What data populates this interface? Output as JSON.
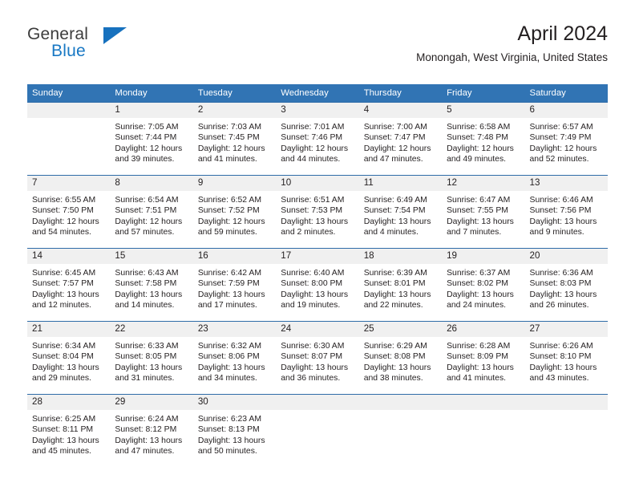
{
  "brand": {
    "name_part1": "General",
    "name_part2": "Blue",
    "accent_color": "#1878c4",
    "triangle_color": "#1771be"
  },
  "header": {
    "title": "April 2024",
    "subtitle": "Monongah, West Virginia, United States"
  },
  "calendar": {
    "header_bg": "#3174b4",
    "daynum_bg": "#f0f0f0",
    "columns": [
      "Sunday",
      "Monday",
      "Tuesday",
      "Wednesday",
      "Thursday",
      "Friday",
      "Saturday"
    ],
    "weeks": [
      [
        {
          "day": "",
          "empty": true
        },
        {
          "day": "1",
          "sunrise": "Sunrise: 7:05 AM",
          "sunset": "Sunset: 7:44 PM",
          "daylight": "Daylight: 12 hours and 39 minutes."
        },
        {
          "day": "2",
          "sunrise": "Sunrise: 7:03 AM",
          "sunset": "Sunset: 7:45 PM",
          "daylight": "Daylight: 12 hours and 41 minutes."
        },
        {
          "day": "3",
          "sunrise": "Sunrise: 7:01 AM",
          "sunset": "Sunset: 7:46 PM",
          "daylight": "Daylight: 12 hours and 44 minutes."
        },
        {
          "day": "4",
          "sunrise": "Sunrise: 7:00 AM",
          "sunset": "Sunset: 7:47 PM",
          "daylight": "Daylight: 12 hours and 47 minutes."
        },
        {
          "day": "5",
          "sunrise": "Sunrise: 6:58 AM",
          "sunset": "Sunset: 7:48 PM",
          "daylight": "Daylight: 12 hours and 49 minutes."
        },
        {
          "day": "6",
          "sunrise": "Sunrise: 6:57 AM",
          "sunset": "Sunset: 7:49 PM",
          "daylight": "Daylight: 12 hours and 52 minutes."
        }
      ],
      [
        {
          "day": "7",
          "sunrise": "Sunrise: 6:55 AM",
          "sunset": "Sunset: 7:50 PM",
          "daylight": "Daylight: 12 hours and 54 minutes."
        },
        {
          "day": "8",
          "sunrise": "Sunrise: 6:54 AM",
          "sunset": "Sunset: 7:51 PM",
          "daylight": "Daylight: 12 hours and 57 minutes."
        },
        {
          "day": "9",
          "sunrise": "Sunrise: 6:52 AM",
          "sunset": "Sunset: 7:52 PM",
          "daylight": "Daylight: 12 hours and 59 minutes."
        },
        {
          "day": "10",
          "sunrise": "Sunrise: 6:51 AM",
          "sunset": "Sunset: 7:53 PM",
          "daylight": "Daylight: 13 hours and 2 minutes."
        },
        {
          "day": "11",
          "sunrise": "Sunrise: 6:49 AM",
          "sunset": "Sunset: 7:54 PM",
          "daylight": "Daylight: 13 hours and 4 minutes."
        },
        {
          "day": "12",
          "sunrise": "Sunrise: 6:47 AM",
          "sunset": "Sunset: 7:55 PM",
          "daylight": "Daylight: 13 hours and 7 minutes."
        },
        {
          "day": "13",
          "sunrise": "Sunrise: 6:46 AM",
          "sunset": "Sunset: 7:56 PM",
          "daylight": "Daylight: 13 hours and 9 minutes."
        }
      ],
      [
        {
          "day": "14",
          "sunrise": "Sunrise: 6:45 AM",
          "sunset": "Sunset: 7:57 PM",
          "daylight": "Daylight: 13 hours and 12 minutes."
        },
        {
          "day": "15",
          "sunrise": "Sunrise: 6:43 AM",
          "sunset": "Sunset: 7:58 PM",
          "daylight": "Daylight: 13 hours and 14 minutes."
        },
        {
          "day": "16",
          "sunrise": "Sunrise: 6:42 AM",
          "sunset": "Sunset: 7:59 PM",
          "daylight": "Daylight: 13 hours and 17 minutes."
        },
        {
          "day": "17",
          "sunrise": "Sunrise: 6:40 AM",
          "sunset": "Sunset: 8:00 PM",
          "daylight": "Daylight: 13 hours and 19 minutes."
        },
        {
          "day": "18",
          "sunrise": "Sunrise: 6:39 AM",
          "sunset": "Sunset: 8:01 PM",
          "daylight": "Daylight: 13 hours and 22 minutes."
        },
        {
          "day": "19",
          "sunrise": "Sunrise: 6:37 AM",
          "sunset": "Sunset: 8:02 PM",
          "daylight": "Daylight: 13 hours and 24 minutes."
        },
        {
          "day": "20",
          "sunrise": "Sunrise: 6:36 AM",
          "sunset": "Sunset: 8:03 PM",
          "daylight": "Daylight: 13 hours and 26 minutes."
        }
      ],
      [
        {
          "day": "21",
          "sunrise": "Sunrise: 6:34 AM",
          "sunset": "Sunset: 8:04 PM",
          "daylight": "Daylight: 13 hours and 29 minutes."
        },
        {
          "day": "22",
          "sunrise": "Sunrise: 6:33 AM",
          "sunset": "Sunset: 8:05 PM",
          "daylight": "Daylight: 13 hours and 31 minutes."
        },
        {
          "day": "23",
          "sunrise": "Sunrise: 6:32 AM",
          "sunset": "Sunset: 8:06 PM",
          "daylight": "Daylight: 13 hours and 34 minutes."
        },
        {
          "day": "24",
          "sunrise": "Sunrise: 6:30 AM",
          "sunset": "Sunset: 8:07 PM",
          "daylight": "Daylight: 13 hours and 36 minutes."
        },
        {
          "day": "25",
          "sunrise": "Sunrise: 6:29 AM",
          "sunset": "Sunset: 8:08 PM",
          "daylight": "Daylight: 13 hours and 38 minutes."
        },
        {
          "day": "26",
          "sunrise": "Sunrise: 6:28 AM",
          "sunset": "Sunset: 8:09 PM",
          "daylight": "Daylight: 13 hours and 41 minutes."
        },
        {
          "day": "27",
          "sunrise": "Sunrise: 6:26 AM",
          "sunset": "Sunset: 8:10 PM",
          "daylight": "Daylight: 13 hours and 43 minutes."
        }
      ],
      [
        {
          "day": "28",
          "sunrise": "Sunrise: 6:25 AM",
          "sunset": "Sunset: 8:11 PM",
          "daylight": "Daylight: 13 hours and 45 minutes."
        },
        {
          "day": "29",
          "sunrise": "Sunrise: 6:24 AM",
          "sunset": "Sunset: 8:12 PM",
          "daylight": "Daylight: 13 hours and 47 minutes."
        },
        {
          "day": "30",
          "sunrise": "Sunrise: 6:23 AM",
          "sunset": "Sunset: 8:13 PM",
          "daylight": "Daylight: 13 hours and 50 minutes."
        },
        {
          "day": "",
          "empty": true
        },
        {
          "day": "",
          "empty": true
        },
        {
          "day": "",
          "empty": true
        },
        {
          "day": "",
          "empty": true
        }
      ]
    ]
  }
}
